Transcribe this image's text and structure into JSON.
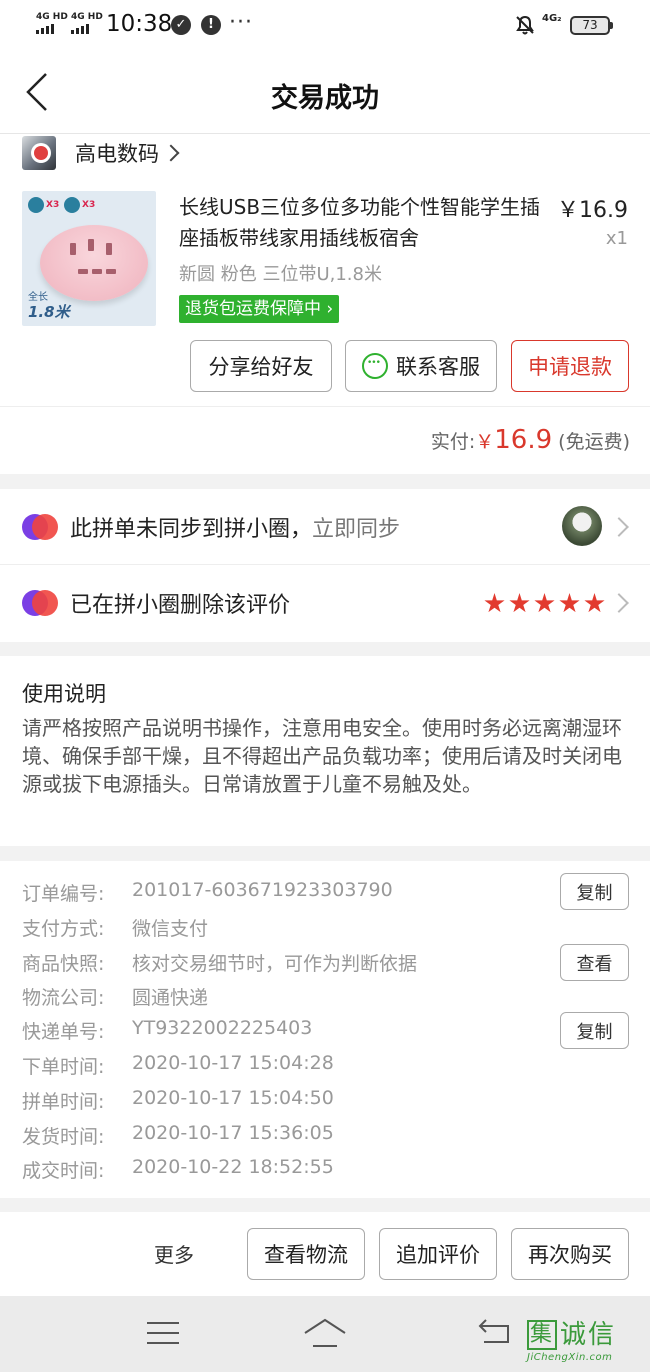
{
  "status_bar": {
    "network_left_1": "4G HD",
    "network_left_2": "4G HD",
    "time": "10:38",
    "circle_icon_1": "✓",
    "circle_icon_2": "!",
    "dots": "···",
    "network_right": "4G₂",
    "battery": "73"
  },
  "header": {
    "title": "交易成功"
  },
  "store": {
    "name": "高电数码"
  },
  "product": {
    "image_badge_1": "X3",
    "image_badge_2": "X3",
    "image_label_1": "全长",
    "image_label_2": "1.8米",
    "title": "长线USB三位多位多功能个性智能学生插座插板带线家用插线板宿舍",
    "price": "￥16.9",
    "quantity": "x1",
    "spec": "新圆 粉色 三位带U,1.8米",
    "guarantee": "退货包运费保障中"
  },
  "actions": {
    "share": "分享给好友",
    "contact": "联系客服",
    "refund": "申请退款"
  },
  "total": {
    "label": "实付:",
    "currency": "￥",
    "amount": "16.9",
    "shipping": "(免运费)"
  },
  "circle": {
    "row1_text": "此拼单未同步到拼小圈，",
    "row1_link": "立即同步",
    "row2_text": "已在拼小圈删除该评价",
    "rating": 5
  },
  "usage": {
    "title": "使用说明",
    "body": "请严格按照产品说明书操作，注意用电安全。使用时务必远离潮湿环境、确保手部干燥，且不得超出产品负载功率；使用后请及时关闭电源或拔下电源插头。日常请放置于儿童不易触及处。"
  },
  "details": {
    "rows": [
      {
        "label": "订单编号:",
        "value": "201017-603671923303790"
      },
      {
        "label": "支付方式:",
        "value": "微信支付"
      },
      {
        "label": "商品快照:",
        "value": "核对交易细节时，可作为判断依据"
      },
      {
        "label": "物流公司:",
        "value": "圆通快递"
      },
      {
        "label": "快递单号:",
        "value": "YT9322002225403"
      },
      {
        "label": "下单时间:",
        "value": "2020-10-17 15:04:28"
      },
      {
        "label": "拼单时间:",
        "value": "2020-10-17 15:04:50"
      },
      {
        "label": "发货时间:",
        "value": "2020-10-17 15:36:05"
      },
      {
        "label": "成交时间:",
        "value": "2020-10-22 18:52:55"
      }
    ],
    "copy_button": "复制",
    "view_button": "查看",
    "copy_button_2": "复制"
  },
  "bottom_bar": {
    "more": "更多",
    "logistics": "查看物流",
    "add_review": "追加评价",
    "buy_again": "再次购买"
  },
  "watermark": {
    "logo_char": "集",
    "cn": "诚信",
    "en": "JiChengXin.com"
  },
  "colors": {
    "accent_red": "#d9382c",
    "guarantee_green": "#2fb12f",
    "star_red": "#e23b2f"
  }
}
